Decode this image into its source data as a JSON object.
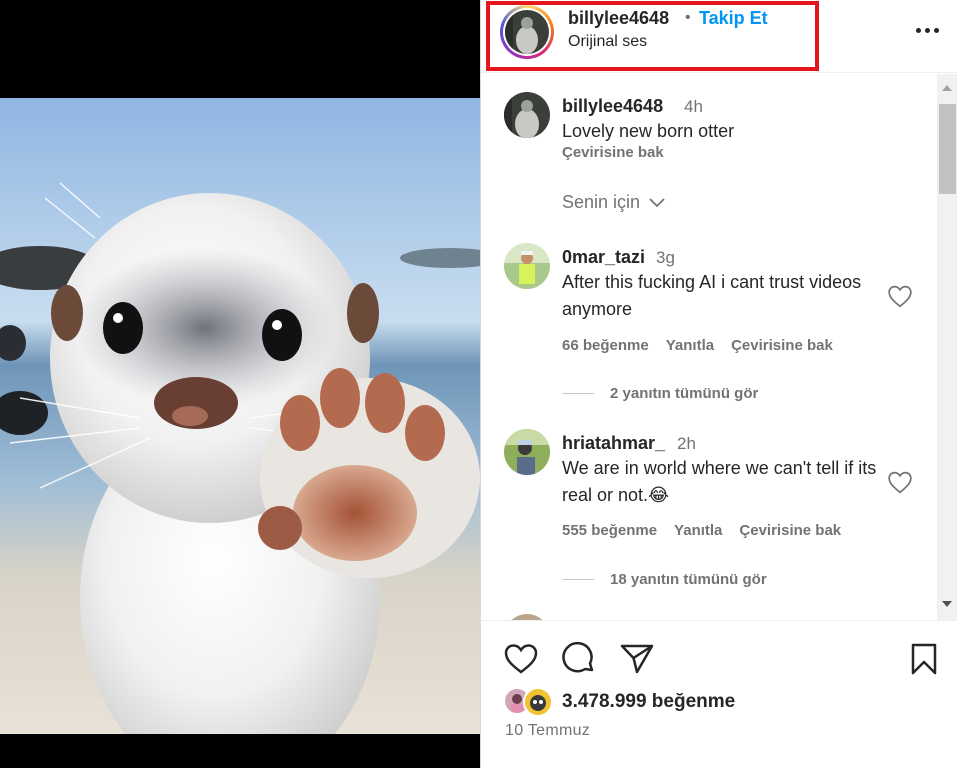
{
  "post": {
    "author": {
      "username": "billylee4648",
      "separator": "•",
      "follow_label": "Takip Et",
      "audio_label": "Orijinal ses"
    },
    "caption": {
      "username": "billylee4648",
      "time": "4h",
      "text": "Lovely new born otter",
      "translate_label": "Çevirisine bak"
    },
    "sort_label": "Senin için",
    "comments": [
      {
        "username": "0mar_tazi",
        "time": "3g",
        "text": "After this fucking AI i cant trust videos anymore",
        "likes": "66 beğenme",
        "reply_label": "Yanıtla",
        "translate_label": "Çevirisine bak",
        "view_replies": "2 yanıtın tümünü gör"
      },
      {
        "username": "hriatahmar_",
        "time": "2h",
        "text": "We are in world where we can't tell if its real or not.😂",
        "likes": "555 beğenme",
        "reply_label": "Yanıtla",
        "translate_label": "Çevirisine bak",
        "view_replies": "18 yanıtın tümünü gör"
      }
    ],
    "likes_count": "3.478.999 beğenme",
    "date": "10 Temmuz"
  },
  "icons": {
    "more": "more-options-icon",
    "like": "heart-icon",
    "comment": "comment-bubble-icon",
    "share": "paper-plane-icon",
    "save": "bookmark-icon",
    "sort": "chevron-down-icon"
  },
  "colors": {
    "link_blue": "#0095f6",
    "highlight_red": "#e3161c",
    "text_primary": "#262626",
    "text_secondary": "#737373"
  }
}
